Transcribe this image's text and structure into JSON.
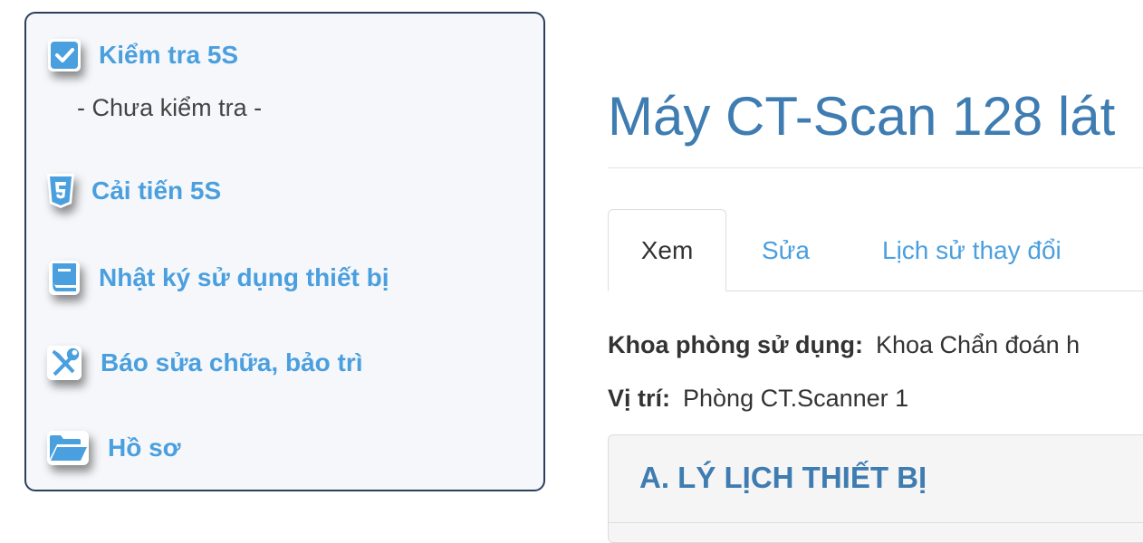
{
  "sidebar": {
    "items": [
      {
        "label": "Kiểm tra 5S",
        "icon": "checkbox-icon",
        "status": "- Chưa kiểm tra -"
      },
      {
        "label": "Cải tiến 5S",
        "icon": "html5-icon"
      },
      {
        "label": "Nhật ký sử dụng thiết bị",
        "icon": "book-icon"
      },
      {
        "label": "Báo sửa chữa, bảo trì",
        "icon": "tools-icon"
      },
      {
        "label": "Hồ sơ",
        "icon": "folder-open-icon"
      }
    ]
  },
  "main": {
    "title": "Máy CT-Scan 128 lát",
    "tabs": [
      {
        "label": "Xem",
        "active": true
      },
      {
        "label": "Sửa",
        "active": false
      },
      {
        "label": "Lịch sử thay đổi",
        "active": false
      }
    ],
    "fields": [
      {
        "key": "Khoa phòng sử dụng:",
        "value": "Khoa Chẩn đoán h"
      },
      {
        "key": "Vị trí:",
        "value": "Phòng CT.Scanner 1"
      }
    ],
    "section_title": "A. LÝ LỊCH THIẾT BỊ"
  },
  "colors": {
    "accent": "#4a9fdf",
    "title": "#3e7cb1",
    "sidebar_border": "#2b3f5c",
    "sidebar_bg": "#f5f7fa"
  }
}
